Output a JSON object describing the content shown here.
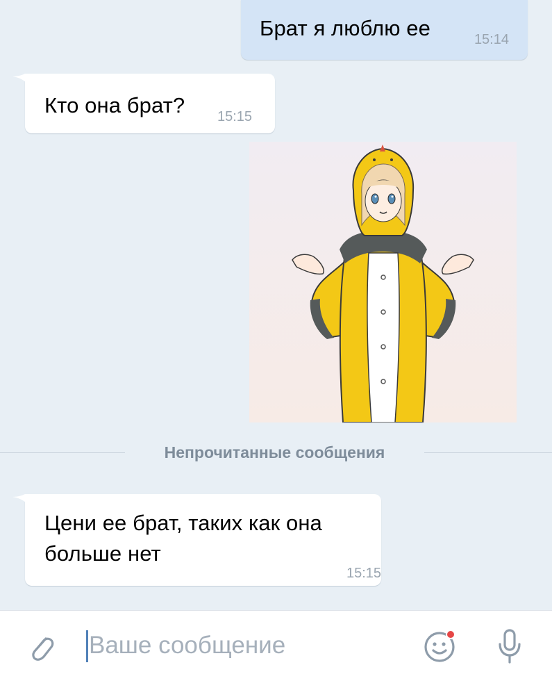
{
  "messages": [
    {
      "id": "msg1",
      "direction": "out",
      "text": "Брат я люблю ее",
      "time": "15:14"
    },
    {
      "id": "msg2",
      "direction": "in",
      "text": "Кто она брат?",
      "time": "15:15"
    },
    {
      "id": "sticker",
      "direction": "out",
      "type": "sticker",
      "description_icon": "anime-girl-chick-costume-sticker"
    },
    {
      "id": "msg3",
      "direction": "in",
      "text": "Цени ее брат, таких как она больше нет",
      "time": "15:15"
    }
  ],
  "divider": {
    "label": "Непрочитанные сообщения"
  },
  "composer": {
    "placeholder": "Ваше сообщение",
    "attach_icon": "paperclip-icon",
    "sticker_icon": "smiley-icon",
    "mic_icon": "microphone-icon"
  },
  "colors": {
    "chat_background": "#e8eff5",
    "outgoing_bubble": "#d4e4f6",
    "incoming_bubble": "#ffffff",
    "accent": "#5181b8",
    "notification_dot": "#e64646"
  }
}
